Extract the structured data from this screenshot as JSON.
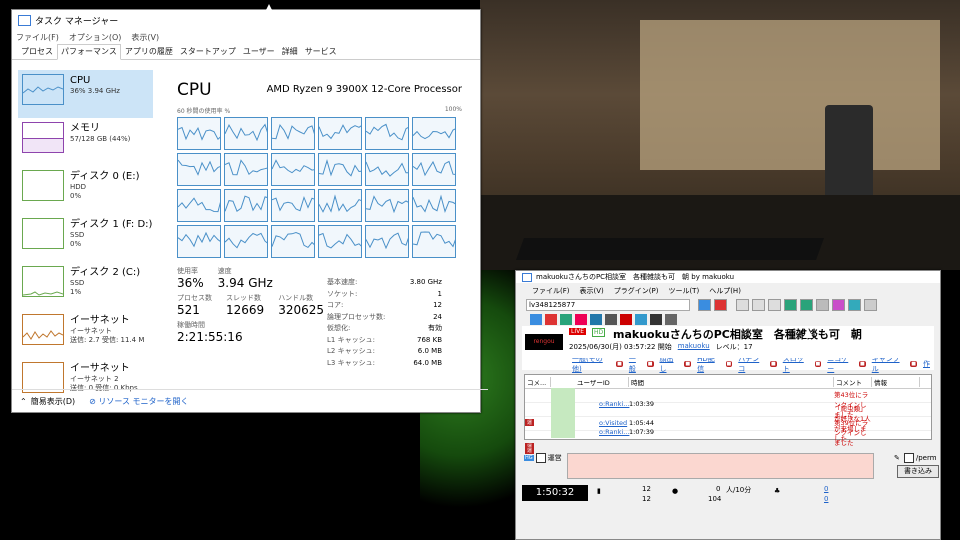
{
  "task_manager": {
    "title": "タスク マネージャー",
    "menu": [
      "ファイル(F)",
      "オプション(O)",
      "表示(V)"
    ],
    "tabs": [
      "プロセス",
      "パフォーマンス",
      "アプリの履歴",
      "スタートアップ",
      "ユーザー",
      "詳細",
      "サービス"
    ],
    "sidebar": [
      {
        "title": "CPU",
        "line1": "36%  3.94 GHz",
        "line2": "",
        "color": "#4a90c8"
      },
      {
        "title": "メモリ",
        "line1": "57/128 GB (44%)",
        "line2": "",
        "color": "#8e44ad"
      },
      {
        "title": "ディスク 0 (E:)",
        "line1": "HDD",
        "line2": "0%",
        "color": "#6aa84f"
      },
      {
        "title": "ディスク 1 (F: D:)",
        "line1": "SSD",
        "line2": "0%",
        "color": "#6aa84f"
      },
      {
        "title": "ディスク 2 (C:)",
        "line1": "SSD",
        "line2": "1%",
        "color": "#6aa84f"
      },
      {
        "title": "イーサネット",
        "line1": "イーサネット",
        "line2": "送信: 2.7  受信: 11.4 M",
        "color": "#c0772e"
      },
      {
        "title": "イーサネット",
        "line1": "イーサネット 2",
        "line2": "送信: 0  受信: 0 Kbps",
        "color": "#c0772e"
      }
    ],
    "main": {
      "title": "CPU",
      "model": "AMD Ryzen 9 3900X 12-Core Processor",
      "graph_caption_left": "60 秒間の使用率 %",
      "graph_caption_right": "100%",
      "usage_label": "使用率",
      "usage_value": "36%",
      "speed_label": "速度",
      "speed_value": "3.94 GHz",
      "process_label": "プロセス数",
      "process_value": "521",
      "thread_label": "スレッド数",
      "thread_value": "12669",
      "handle_label": "ハンドル数",
      "handle_value": "320625",
      "uptime_label": "稼働時間",
      "uptime_value": "2:21:55:16",
      "details": [
        [
          "基本速度:",
          "3.80 GHz"
        ],
        [
          "ソケット:",
          "1"
        ],
        [
          "コア:",
          "12"
        ],
        [
          "論理プロセッサ数:",
          "24"
        ],
        [
          "仮想化:",
          "有効"
        ],
        [
          "L1 キャッシュ:",
          "768 KB"
        ],
        [
          "L2 キャッシュ:",
          "6.0 MB"
        ],
        [
          "L3 キャッシュ:",
          "64.0 MB"
        ]
      ]
    },
    "footer": {
      "fewer_details": "簡易表示(D)",
      "resource_monitor": "リソース モニターを開く"
    }
  },
  "nicocas": {
    "title": "makuokuさんちのPC相談室　各種雑談も可　朝 by makuoku",
    "menu": [
      "ファイル(F)",
      "表示(V)",
      "プラグイン(P)",
      "ツール(T)",
      "ヘルプ(H)"
    ],
    "live_id": "lv348125877",
    "live_badge": "LIVE",
    "hd_badge": "HD",
    "live_title": "makuokuさんちのPC相談室　各種雑談も可　朝",
    "date": "2025/06/30(月) 03:57:22 開始",
    "owner": "makuoku",
    "level": "レベル：17",
    "categories": [
      "一般(その他)",
      "一般",
      "顔出し",
      "HD配信",
      "パチンコ",
      "スロット",
      "ニコゲー",
      "ギャンブル",
      "作"
    ],
    "columns": [
      "コメ...",
      "",
      "ユーザーID",
      "時間",
      "コメント",
      "",
      "情報"
    ],
    "comments": [
      {
        "uid": "o:Ranki...",
        "time": "1:03:39",
        "text": "第43位にランクインしました",
        "info": "運"
      },
      {
        "uid": "o:Visited",
        "time": "1:05:44",
        "text": "「爬虫類」が好きな1人が来場しました",
        "info": "運"
      },
      {
        "uid": "o:Ranki...",
        "time": "1:07:39",
        "text": "第39位にランクインしました",
        "info": "運"
      }
    ],
    "input": {
      "unei_label": "運営",
      "perm_label": "/perm",
      "write_button": "書き込み"
    },
    "status": {
      "timer": "1:50:32",
      "a1": "12",
      "a2": "12",
      "b1": "0",
      "b2": "人/10分",
      "b3": "104",
      "c1": "0",
      "c2": "0"
    }
  }
}
